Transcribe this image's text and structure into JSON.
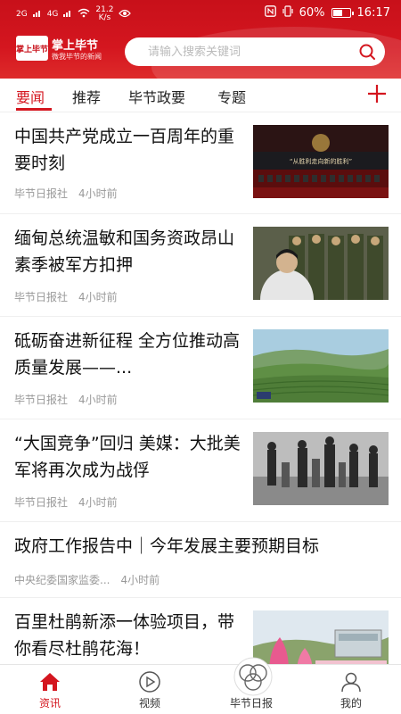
{
  "status_bar": {
    "network_left": "2G",
    "network_right": "4G",
    "speed_value": "21.2",
    "speed_unit": "K/s",
    "battery": "60%",
    "battery_level": 0.6,
    "time": "16:17"
  },
  "header": {
    "logo_text": "掌上毕节",
    "brand_title": "掌上毕节",
    "brand_slogan": "微我毕节的新闻",
    "search_placeholder": "请输入搜索关键词"
  },
  "tabs": [
    {
      "label": "要闻",
      "active": true
    },
    {
      "label": "推荐",
      "active": false
    },
    {
      "label": "毕节政要",
      "active": false
    },
    {
      "label": "专题",
      "active": false
    }
  ],
  "news": [
    {
      "title": "中国共产党成立一百周年的重要时刻",
      "source": "毕节日报社",
      "time": "4小时前",
      "thumb_caption": "“从胜利走向新的胜利”"
    },
    {
      "title": "缅甸总统温敏和国务资政昂山素季被军方扣押",
      "source": "毕节日报社",
      "time": "4小时前"
    },
    {
      "title": "砥砺奋进新征程 全方位推动高质量发展——...",
      "source": "毕节日报社",
      "time": "4小时前"
    },
    {
      "title": "“大国竞争”回归 美媒：大批美军将再次成为战俘",
      "source": "毕节日报社",
      "time": "4小时前"
    },
    {
      "title": "政府工作报告中｜今年发展主要预期目标",
      "source": "中央纪委国家监委...",
      "time": "4小时前"
    },
    {
      "title": "百里杜鹃新添一体验项目，带你看尽杜鹃花海！",
      "source": "毕节日报社",
      "time": "4小时前"
    }
  ],
  "bottom_nav": [
    {
      "label": "资讯",
      "icon": "home-icon",
      "active": true
    },
    {
      "label": "视频",
      "icon": "video-icon",
      "active": false
    },
    {
      "label": "毕节日报",
      "icon": "newspaper-logo-icon",
      "active": false
    },
    {
      "label": "我的",
      "icon": "user-icon",
      "active": false
    }
  ],
  "colors": {
    "brand_red": "#d4161f",
    "text": "#111111",
    "meta": "#999999"
  }
}
